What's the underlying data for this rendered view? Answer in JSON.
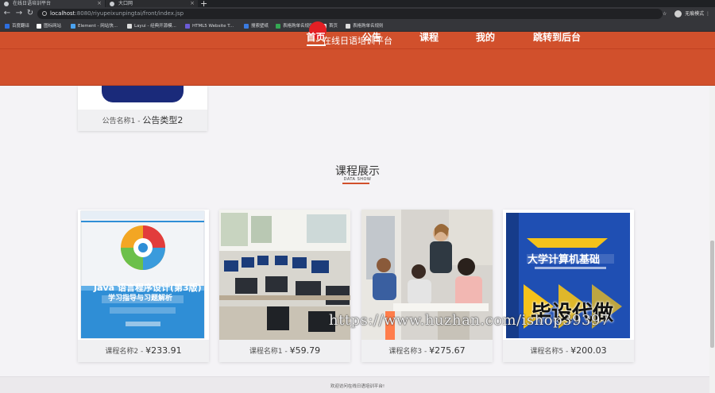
{
  "browser": {
    "tabs": [
      {
        "label": "在线日语培训平台",
        "active": true
      },
      {
        "label": "大口网",
        "active": false
      }
    ],
    "new_tab": "+",
    "nav": {
      "back": "←",
      "forward": "→",
      "reload": "↻"
    },
    "url_host": "localhost",
    "url_path": ":8080/riyupeixunpingtai/front/index.jsp",
    "incognito_label": "无痕模式",
    "bookmarks": [
      {
        "label": "百度翻译",
        "color": "#2d6fe0"
      },
      {
        "label": "图标网站",
        "color": "#ffffff"
      },
      {
        "label": "Element - 网站快...",
        "color": "#4aa3f0"
      },
      {
        "label": "Layui - 经典开源模...",
        "color": "#dddddd"
      },
      {
        "label": "HTML5 Website T...",
        "color": "#6b5bd6"
      },
      {
        "label": "搜索壁纸",
        "color": "#3a7be0"
      },
      {
        "label": "表格购单名规则",
        "color": "#34a853"
      },
      {
        "label": "首页",
        "color": "#dddddd"
      },
      {
        "label": "表格购单名规则",
        "color": "#dddddd"
      }
    ]
  },
  "site": {
    "title": "在线日语培训平台",
    "accent": "#d1502c",
    "nav": [
      {
        "label": "首页",
        "active": true
      },
      {
        "label": "公告",
        "active": false
      },
      {
        "label": "课程",
        "active": false
      },
      {
        "label": "我的",
        "active": false
      },
      {
        "label": "跳转到后台",
        "active": false
      }
    ]
  },
  "notice": {
    "name": "公告名称1",
    "separator": " - ",
    "type": "公告类型2"
  },
  "section": {
    "title": "课程展示",
    "subtitle": "DATA SHOW"
  },
  "courses": [
    {
      "name": "课程名称2",
      "separator": " - ",
      "price": "¥233.91",
      "image": "book-java-cover"
    },
    {
      "name": "课程名称1",
      "separator": " - ",
      "price": "¥59.79",
      "image": "computer-lab-photo"
    },
    {
      "name": "课程名称3",
      "separator": " - ",
      "price": "¥275.67",
      "image": "classroom-students-photo"
    },
    {
      "name": "课程名称5",
      "separator": " - ",
      "price": "¥200.03",
      "image": "book-university-computer-cover"
    }
  ],
  "book_covers": {
    "java_title": "Java 语言程序设计(第3版)",
    "java_subtitle": "学习指导与习题解析",
    "computer_title": "大学计算机基础"
  },
  "watermark": {
    "url": "https://www.huzhan.com/ishop39397",
    "text": "毕设代做"
  },
  "footer": {
    "text": "欢迎访问在线日语培训平台!"
  }
}
